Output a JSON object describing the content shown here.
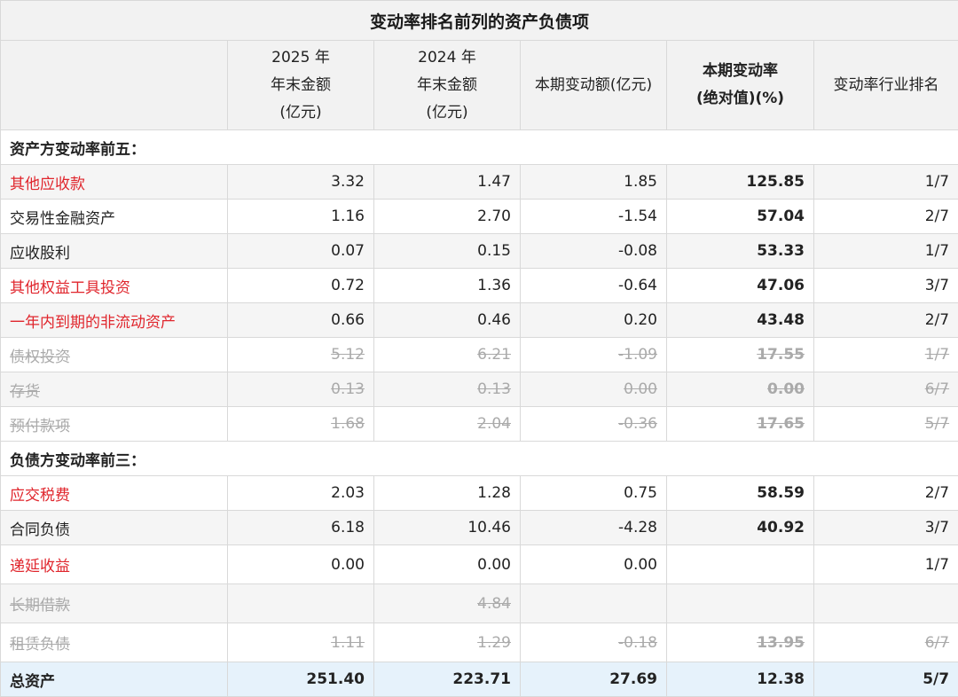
{
  "title": "变动率排名前列的资产负债项",
  "headers": {
    "col1_lines": [
      "2025 年",
      "年末金额",
      "(亿元)"
    ],
    "col2_lines": [
      "2024 年",
      "年末金额",
      "(亿元)"
    ],
    "col3": "本期变动额(亿元)",
    "col4_lines": [
      "本期变动率",
      "(绝对值)(%)"
    ],
    "col5": "变动率行业排名"
  },
  "sections": {
    "assets": "资产方变动率前五：",
    "liabilities": "负债方变动率前三："
  },
  "asset_rows": [
    {
      "name": "其他应收款",
      "v2025": "3.32",
      "v2024": "1.47",
      "change": "1.85",
      "rate": "125.85",
      "rank": "1/7"
    },
    {
      "name": "交易性金融资产",
      "v2025": "1.16",
      "v2024": "2.70",
      "change": "-1.54",
      "rate": "57.04",
      "rank": "2/7"
    },
    {
      "name": "应收股利",
      "v2025": "0.07",
      "v2024": "0.15",
      "change": "-0.08",
      "rate": "53.33",
      "rank": "1/7"
    },
    {
      "name": "其他权益工具投资",
      "v2025": "0.72",
      "v2024": "1.36",
      "change": "-0.64",
      "rate": "47.06",
      "rank": "3/7"
    },
    {
      "name": "一年内到期的非流动资产",
      "v2025": "0.66",
      "v2024": "0.46",
      "change": "0.20",
      "rate": "43.48",
      "rank": "2/7"
    },
    {
      "name": "债权投资",
      "v2025": "5.12",
      "v2024": "6.21",
      "change": "-1.09",
      "rate": "17.55",
      "rank": "1/7"
    },
    {
      "name": "存货",
      "v2025": "0.13",
      "v2024": "0.13",
      "change": "0.00",
      "rate": "0.00",
      "rank": "6/7"
    },
    {
      "name": "预付款项",
      "v2025": "1.68",
      "v2024": "2.04",
      "change": "-0.36",
      "rate": "17.65",
      "rank": "5/7"
    }
  ],
  "liability_rows": [
    {
      "name": "应交税费",
      "v2025": "2.03",
      "v2024": "1.28",
      "change": "0.75",
      "rate": "58.59",
      "rank": "2/7"
    },
    {
      "name": "合同负债",
      "v2025": "6.18",
      "v2024": "10.46",
      "change": "-4.28",
      "rate": "40.92",
      "rank": "3/7"
    },
    {
      "name": "递延收益",
      "v2025": "0.00",
      "v2024": "0.00",
      "change": "0.00",
      "rate": "",
      "rank": "1/7"
    },
    {
      "name": "长期借款",
      "v2025": "",
      "v2024": "4.84",
      "change": "",
      "rate": "",
      "rank": ""
    },
    {
      "name": "租赁负债",
      "v2025": "1.11",
      "v2024": "1.29",
      "change": "-0.18",
      "rate": "13.95",
      "rank": "6/7"
    }
  ],
  "total": {
    "name": "总资产",
    "v2025": "251.40",
    "v2024": "223.71",
    "change": "27.69",
    "rate": "12.38",
    "rank": "5/7"
  },
  "colors": {
    "highlight_red": "#e0262d",
    "muted_gray": "#aaaaaa",
    "total_bg": "#e6f2fb",
    "header_bg": "#f2f2f2"
  }
}
